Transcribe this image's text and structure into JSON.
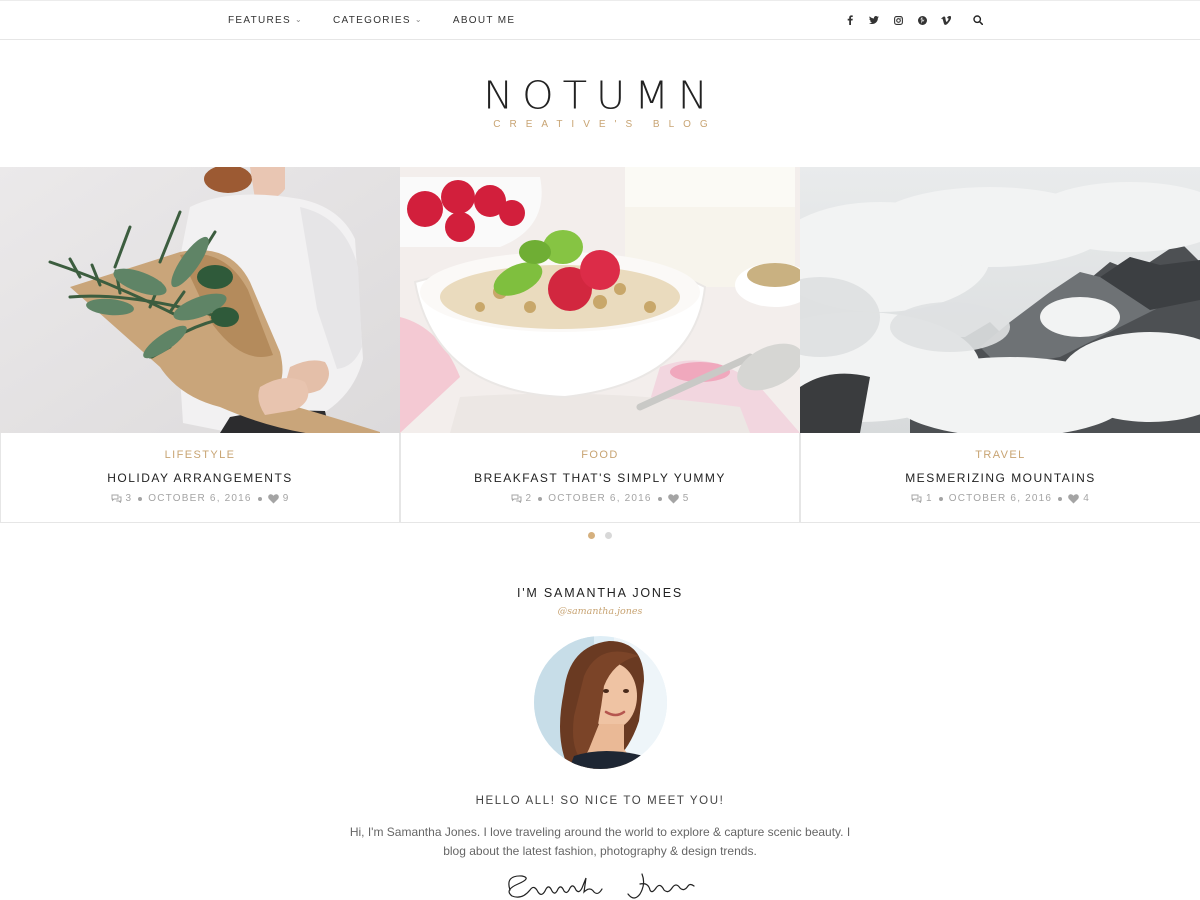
{
  "nav": {
    "items": [
      {
        "label": "FEATURES",
        "has_dropdown": true
      },
      {
        "label": "CATEGORIES",
        "has_dropdown": true
      },
      {
        "label": "ABOUT ME",
        "has_dropdown": false
      }
    ],
    "social_icons": [
      "facebook-icon",
      "twitter-icon",
      "instagram-icon",
      "pinterest-icon",
      "vimeo-icon"
    ],
    "search_icon": "search-icon"
  },
  "logo": {
    "title": "NOTUMN",
    "subtitle": "CREATIVE'S BLOG"
  },
  "colors": {
    "accent": "#c8a473",
    "text": "#222222",
    "muted": "#a4a4a4"
  },
  "slides": [
    {
      "category": "LIFESTYLE",
      "title": "HOLIDAY ARRANGEMENTS",
      "comments": "3",
      "date": "OCTOBER 6, 2016",
      "likes": "9"
    },
    {
      "category": "FOOD",
      "title": "BREAKFAST THAT'S SIMPLY YUMMY",
      "comments": "2",
      "date": "OCTOBER 6, 2016",
      "likes": "5"
    },
    {
      "category": "TRAVEL",
      "title": "MESMERIZING MOUNTAINS",
      "comments": "1",
      "date": "OCTOBER 6, 2016",
      "likes": "4"
    }
  ],
  "slider_pagination": {
    "total": 2,
    "active": 1
  },
  "about": {
    "name": "I'M SAMANTHA JONES",
    "handle": "@samantha.jones",
    "greeting": "HELLO ALL! SO NICE TO MEET YOU!",
    "text": "Hi, I'm Samantha Jones. I love traveling around the world to explore & capture scenic beauty. I blog about the latest fashion, photography & design trends.",
    "signature": "Samantha Jones"
  }
}
